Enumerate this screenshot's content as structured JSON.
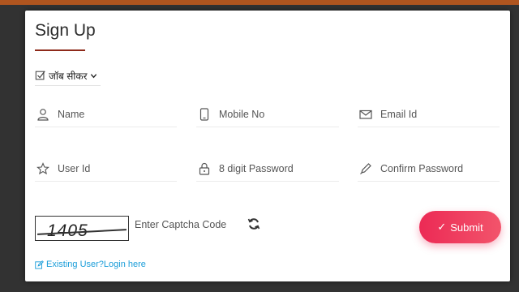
{
  "form": {
    "title": "Sign Up",
    "role_selector": {
      "selected": "जॉब सीकर"
    },
    "fields": {
      "name": {
        "placeholder": "Name",
        "icon": "user-icon"
      },
      "mobile": {
        "placeholder": "Mobile No",
        "icon": "mobile-icon"
      },
      "email": {
        "placeholder": "Email Id",
        "icon": "envelope-icon"
      },
      "user_id": {
        "placeholder": "User Id",
        "icon": "star-icon"
      },
      "password": {
        "placeholder": "8 digit Password",
        "icon": "lock-icon"
      },
      "confirm_password": {
        "placeholder": "Confirm Password",
        "icon": "pencil-icon"
      }
    },
    "captcha": {
      "code": "1405",
      "input_placeholder": "Enter Captcha Code",
      "refresh_icon": "refresh-icon"
    },
    "submit_label": "Submit",
    "existing_user_link": "Existing User?Login here"
  },
  "colors": {
    "accent": "#ec2a55",
    "title_underline": "#8e2a1a",
    "link": "#1a9dd9",
    "top_bar": "#b0551f"
  }
}
